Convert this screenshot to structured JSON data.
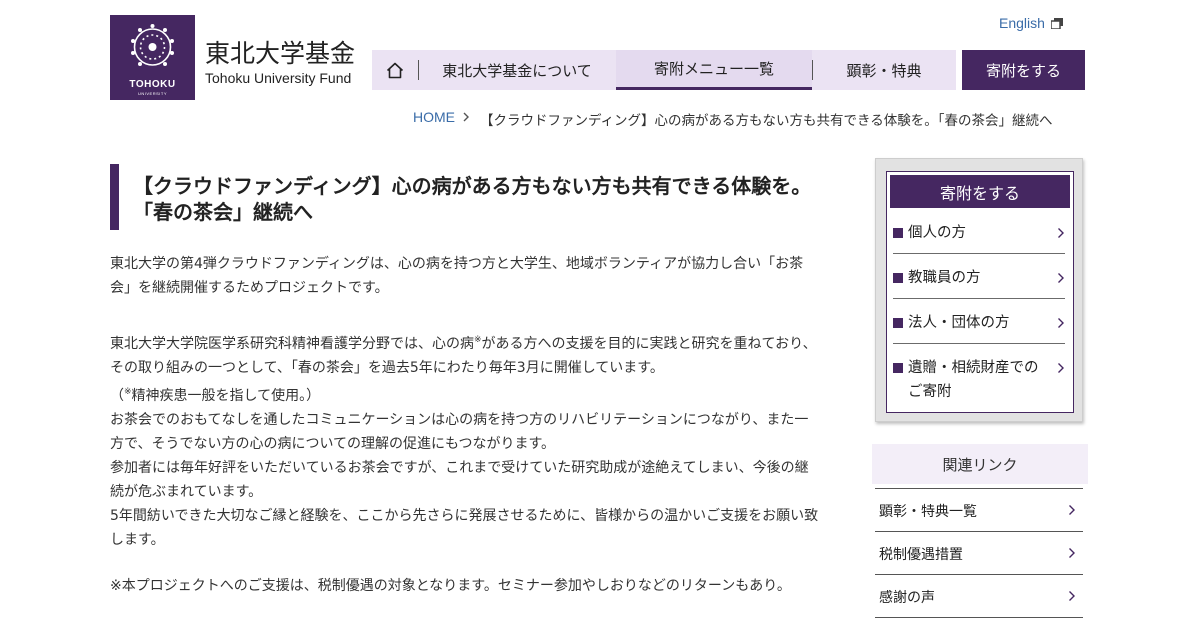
{
  "header": {
    "logo_text": "TOHOKU",
    "logo_subtext": "UNIVERSITY",
    "site_title": "東北大学基金",
    "site_subtitle": "Tohoku University Fund",
    "english_link": "English"
  },
  "nav": {
    "items": [
      {
        "label": "東北大学基金について"
      },
      {
        "label": "寄附メニュー一覧"
      },
      {
        "label": "顕彰・特典"
      }
    ],
    "donate_button": "寄附をする"
  },
  "breadcrumb": {
    "home": "HOME",
    "current": "【クラウドファンディング】心の病がある方もない方も共有できる体験を。「春の茶会」継続へ"
  },
  "main": {
    "title": "【クラウドファンディング】心の病がある方もない方も共有できる体験を。「春の茶会」継続へ",
    "intro": "東北大学の第4弾クラウドファンディングは、心の病を持つ方と大学生、地域ボランティアが協力し合い「お茶会」を継続開催するためプロジェクトです。",
    "body_1a": "東北大学大学院医学系研究科精神看護学分野では、心の病",
    "body_note_mark": "※",
    "body_1b": "がある方への支援を目的に実践と研究を重ねており、その取り組みの一つとして、「春の茶会」を過去5年にわたり毎年3月に開催しています。",
    "body_2_open": "（",
    "body_2_text": "精神疾患一般を指して使用。）",
    "body_3": "お茶会でのおもてなしを通したコミュニケーションは心の病を持つ方のリハビリテーションにつながり、また一方で、そうでない方の心の病についての理解の促進にもつながります。",
    "body_4": "参加者には毎年好評をいただいているお茶会ですが、これまで受けていた研究助成が途絶えてしまい、今後の継続が危ぶまれています。",
    "body_5": "5年間紡いできた大切なご縁と経験を、ここから先さらに発展させるために、皆様からの温かいご支援をお願い致します。",
    "note": "※本プロジェクトへのご支援は、税制優遇の対象となります。セミナー参加やしおりなどのリターンもあり。"
  },
  "sidebar": {
    "donate_title": "寄附をする",
    "donate_items": [
      {
        "label": "個人の方"
      },
      {
        "label": "教職員の方"
      },
      {
        "label": "法人・団体の方"
      },
      {
        "label": "遺贈・相続財産でのご寄附"
      }
    ],
    "related_title": "関連リンク",
    "related_items": [
      {
        "label": "顕彰・特典一覧"
      },
      {
        "label": "税制優遇措置"
      },
      {
        "label": "感謝の声"
      }
    ]
  },
  "colors": {
    "brand": "#452761",
    "nav_bg": "#ebe3f3",
    "link": "#3a6ca8"
  }
}
